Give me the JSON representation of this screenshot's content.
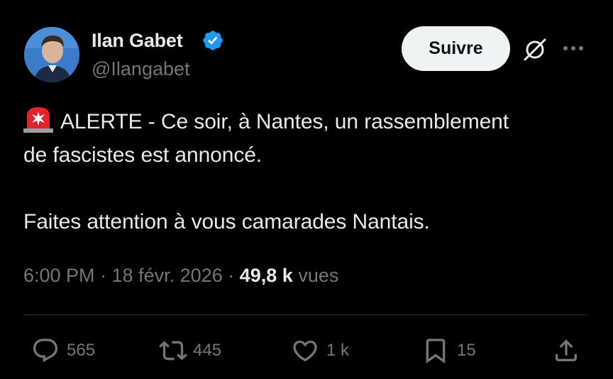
{
  "tweet": {
    "author": {
      "name": "Ilan Gabet",
      "handle": "@Ilangabet",
      "verified": true
    },
    "follow_label": "Suivre",
    "alert_prefix": "ALERTE - Ce soir, à Nantes, un rassemblement",
    "alert_line2": "de fascistes est annoncé.",
    "line3": "Faites attention à vous camarades Nantais.",
    "time": "6:00 PM",
    "date": "18 févr. 2026",
    "separator": "·",
    "views_count": "49,8 k",
    "views_label": "vues"
  },
  "actions": {
    "replies": "565",
    "reposts": "445",
    "likes": "1 k",
    "bookmarks": "15"
  },
  "colors": {
    "background": "#000000",
    "text": "#e7e9ea",
    "muted": "#71767b",
    "verified": "#1d9bf0",
    "divider": "#2f3336",
    "button_bg": "#eff3f4"
  },
  "icons": [
    "verified-badge-icon",
    "grok-icon",
    "more-icon",
    "siren-icon",
    "reply-icon",
    "repost-icon",
    "like-icon",
    "bookmark-icon",
    "share-icon"
  ]
}
